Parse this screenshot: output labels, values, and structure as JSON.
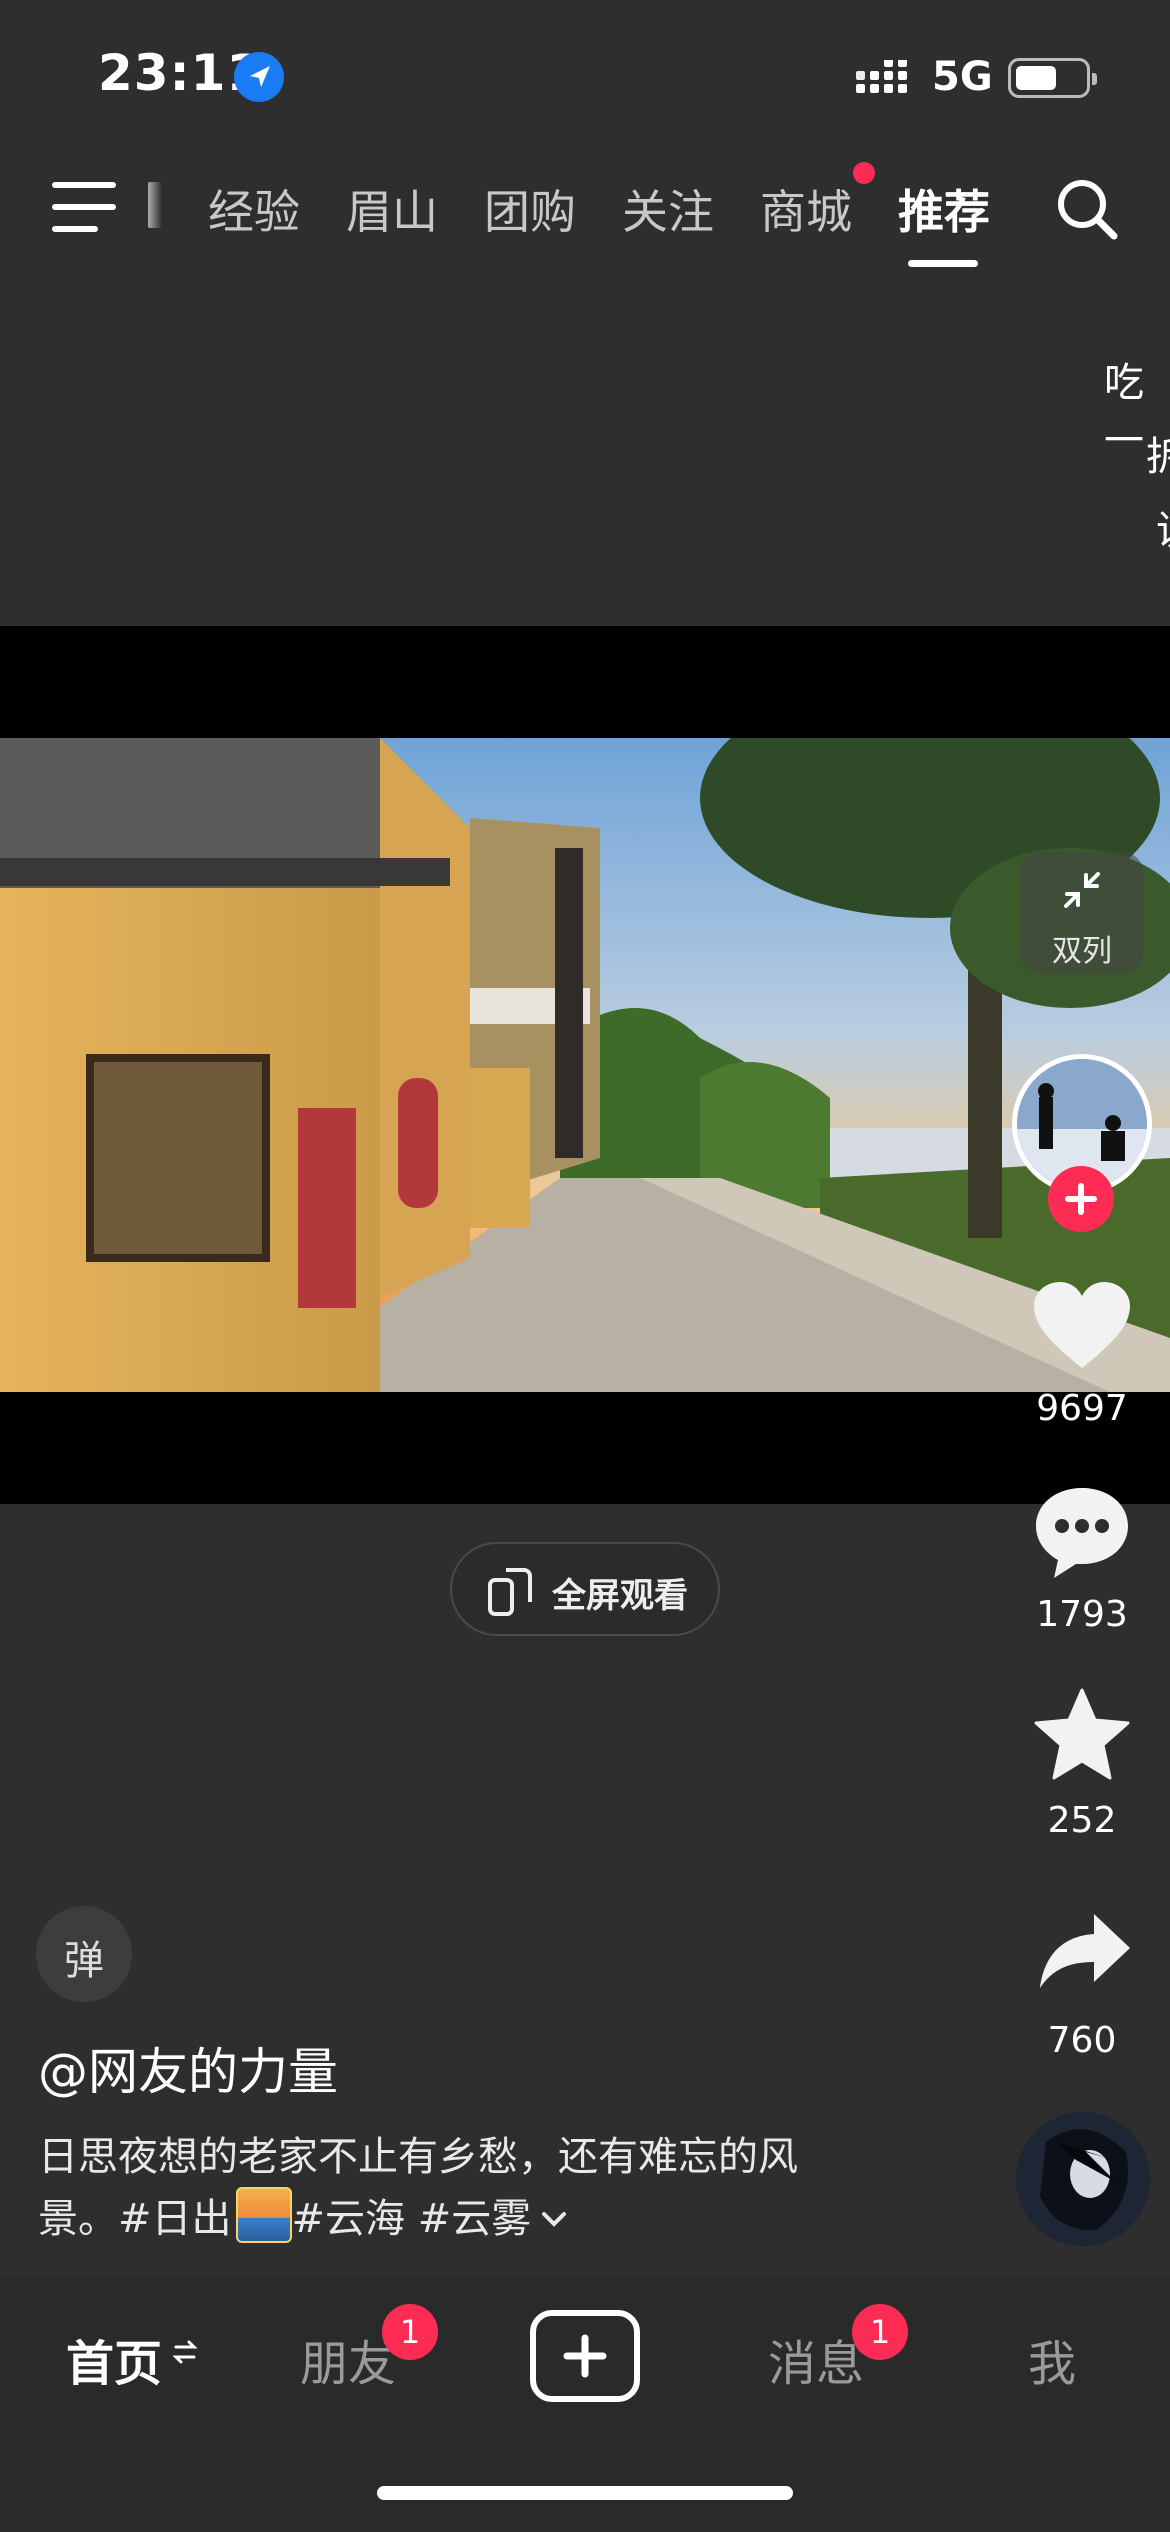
{
  "status_bar": {
    "time": "23:11",
    "network": "5G",
    "icons": [
      "location-arrow-icon",
      "signal-icon",
      "battery-icon"
    ]
  },
  "top_nav": {
    "tabs": [
      {
        "label": "经验",
        "active": false
      },
      {
        "label": "眉山",
        "active": false
      },
      {
        "label": "团购",
        "active": false
      },
      {
        "label": "关注",
        "active": false
      },
      {
        "label": "商城",
        "active": false,
        "dot": true
      },
      {
        "label": "推荐",
        "active": true
      }
    ],
    "icons": [
      "menu-icon",
      "search-icon"
    ]
  },
  "peek_text": [
    "吃一",
    "拆",
    "说"
  ],
  "video": {
    "fullscreen_label": "全屏观看",
    "double_column_label": "双列"
  },
  "actions": {
    "likes": "9697",
    "comments": "1793",
    "favorites": "252",
    "shares": "760"
  },
  "post": {
    "danmaku_label": "弹",
    "author": "@网友的力量",
    "caption_line1": "日思夜想的老家不止有乡愁，还有难忘的风",
    "caption_line2_prefix": "景。#日出",
    "caption_line2_suffix": " #云海 #云雾"
  },
  "bottom_tabs": {
    "home": "首页",
    "friends": "朋友",
    "friends_badge": "1",
    "messages": "消息",
    "messages_badge": "1",
    "me": "我"
  },
  "colors": {
    "accent": "#fe2c55",
    "background": "#2e2e2e",
    "location": "#1a7cf5"
  }
}
